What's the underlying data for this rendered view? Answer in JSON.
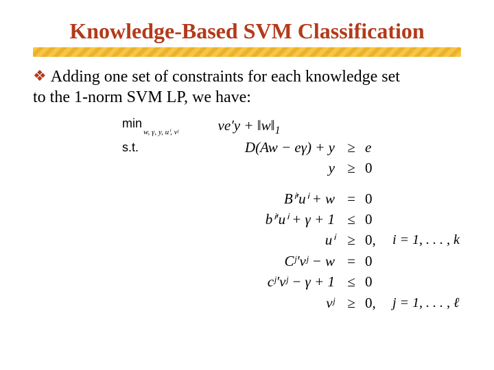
{
  "title": "Knowledge-Based SVM Classification",
  "bullet_glyph": "❖",
  "body_line1": "Adding one set of constraints for each knowledge set",
  "body_line2": "to the 1-norm SVM  LP, we have:",
  "math": {
    "min_label": "min",
    "min_sub_line1": "w, γ, y, uⁱ, vʲ",
    "objective": "νe′y + ‖w‖",
    "objective_sub": "1",
    "st_label": "s.t.",
    "row1_left": "D(Aw − eγ) + y",
    "row1_op": "≥",
    "row1_right": "e",
    "row2_left": "y",
    "row2_op": "≥",
    "row2_right": "0",
    "row3_left": "Bⁱ′uⁱ + w",
    "row3_op": "=",
    "row3_right": "0",
    "row4_left": "bⁱ′uⁱ + γ + 1",
    "row4_op": "≤",
    "row4_right": "0",
    "row5_left": "uⁱ",
    "row5_op": "≥",
    "row5_right": "0,",
    "row5_tail": "i = 1, . . . , k",
    "row6_left": "Cʲ′vʲ − w",
    "row6_op": "=",
    "row6_right": "0",
    "row7_left": "cʲ′vʲ − γ + 1",
    "row7_op": "≤",
    "row7_right": "0",
    "row8_left": "vʲ",
    "row8_op": "≥",
    "row8_right": "0,",
    "row8_tail": "j = 1, . . . , ℓ"
  }
}
